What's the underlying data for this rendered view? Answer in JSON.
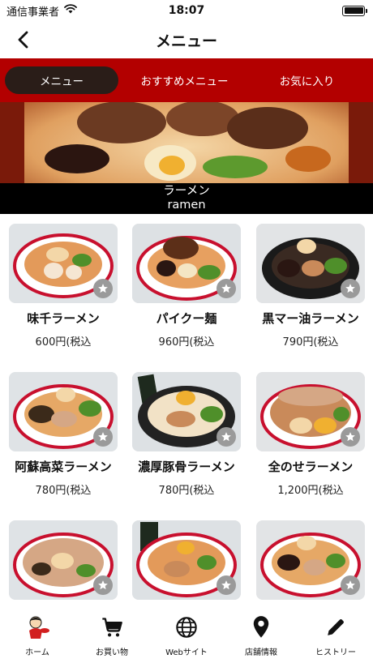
{
  "status_bar": {
    "carrier": "通信事業者",
    "time": "18:07"
  },
  "nav": {
    "title": "メニュー"
  },
  "tabs": [
    {
      "label": "メニュー",
      "active": true
    },
    {
      "label": "おすすめメニュー",
      "active": false
    },
    {
      "label": "お気に入り",
      "active": false
    }
  ],
  "hero": {
    "caption_jp": "ラーメン",
    "caption_en": "ramen"
  },
  "items": [
    {
      "name": "味千ラーメン",
      "price": "600円(税込"
    },
    {
      "name": "パイクー麺",
      "price": "960円(税込"
    },
    {
      "name": "黒マー油ラーメン",
      "price": "790円(税込"
    },
    {
      "name": "阿蘇高菜ラーメン",
      "price": "780円(税込"
    },
    {
      "name": "濃厚豚骨ラーメン",
      "price": "780円(税込"
    },
    {
      "name": "全のせラーメン",
      "price": "1,200円(税込"
    },
    {
      "name": "",
      "price": ""
    },
    {
      "name": "",
      "price": ""
    },
    {
      "name": "",
      "price": ""
    }
  ],
  "tabbar": [
    {
      "label": "ホーム",
      "icon": "home-mascot-icon"
    },
    {
      "label": "お買い物",
      "icon": "cart-icon"
    },
    {
      "label": "Webサイト",
      "icon": "globe-icon"
    },
    {
      "label": "店舗情報",
      "icon": "map-pin-icon"
    },
    {
      "label": "ヒストリー",
      "icon": "pencil-icon"
    }
  ],
  "colors": {
    "tab_bar_red": "#b30000",
    "active_tab": "#2a1d18",
    "star_badge": "#9a9a9a"
  }
}
